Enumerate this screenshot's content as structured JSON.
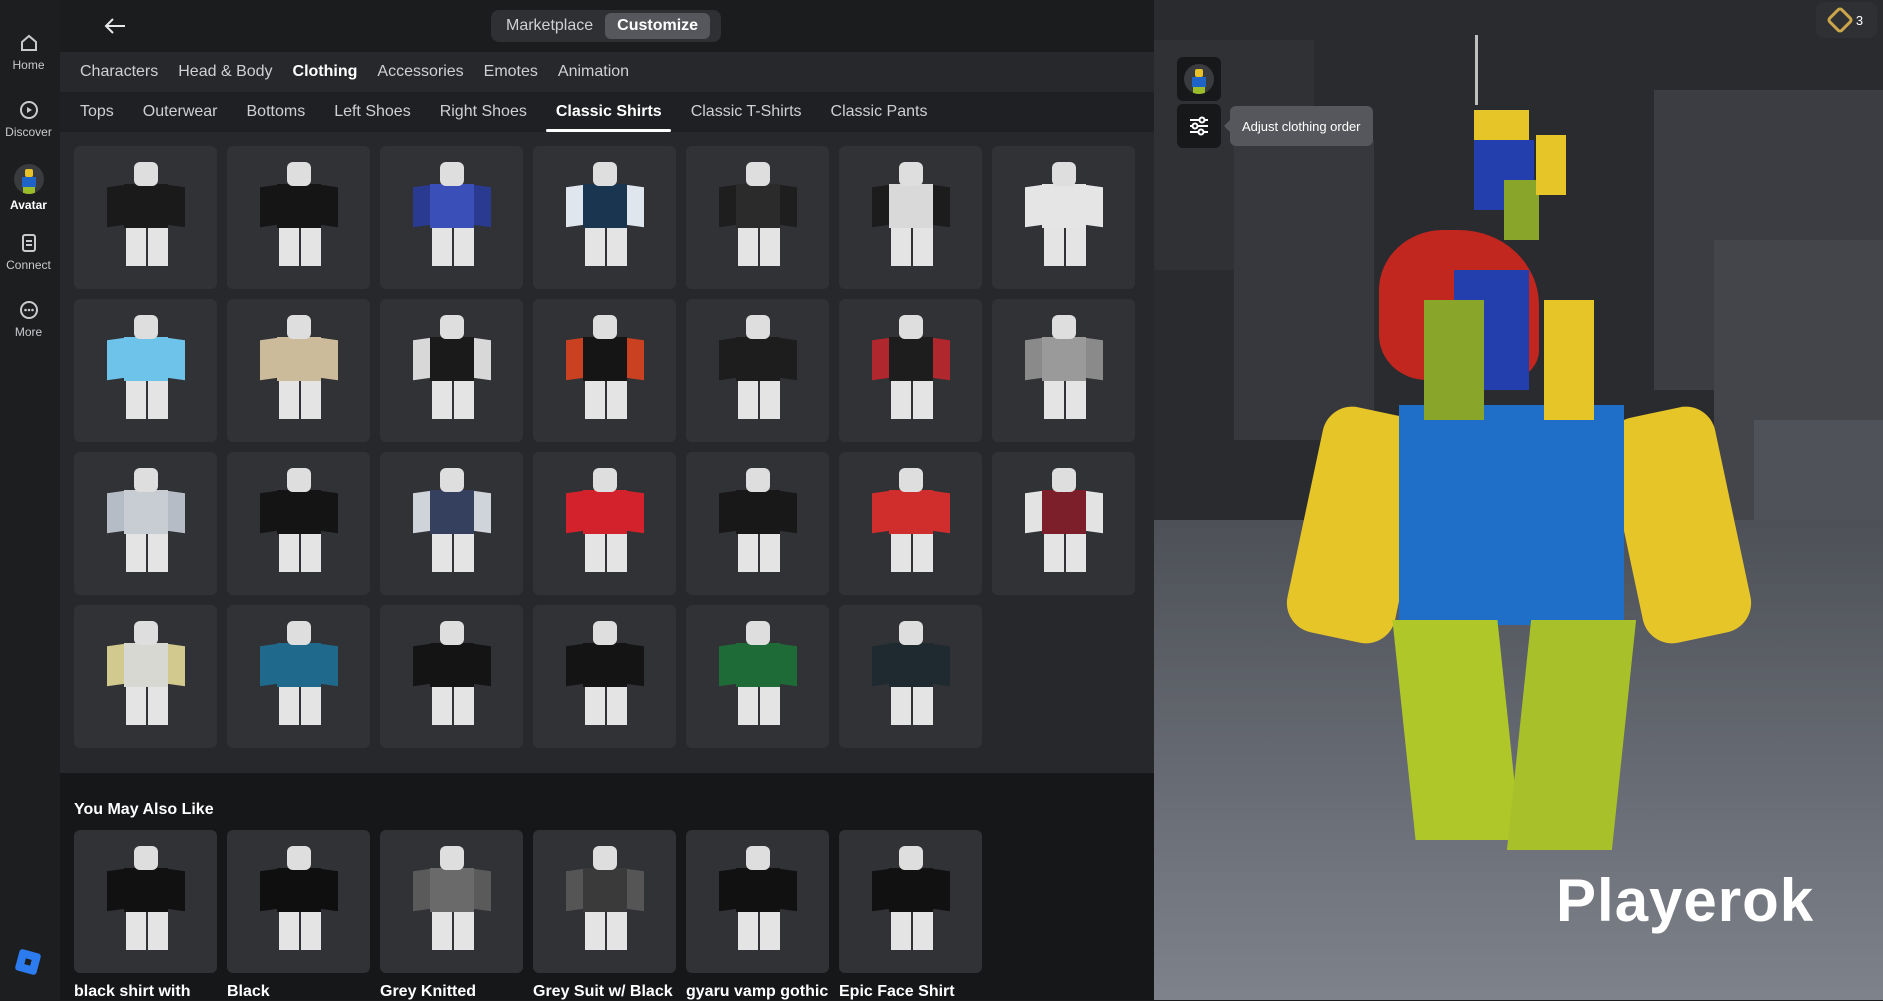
{
  "nav": {
    "items": [
      {
        "label": "Home",
        "icon": "home-icon"
      },
      {
        "label": "Discover",
        "icon": "discover-icon"
      },
      {
        "label": "Avatar",
        "icon": "avatar-icon"
      },
      {
        "label": "Connect",
        "icon": "connect-icon"
      },
      {
        "label": "More",
        "icon": "more-icon"
      }
    ]
  },
  "header": {
    "segments": [
      "Marketplace",
      "Customize"
    ],
    "active_segment": "Customize"
  },
  "categories": [
    "Characters",
    "Head & Body",
    "Clothing",
    "Accessories",
    "Emotes",
    "Animation"
  ],
  "active_category": "Clothing",
  "subcategories": [
    "Tops",
    "Outerwear",
    "Bottoms",
    "Left Shoes",
    "Right Shoes",
    "Classic Shirts",
    "Classic T-Shirts",
    "Classic Pants"
  ],
  "active_subcategory": "Classic Shirts",
  "items": [
    {
      "shirt": "#1a1a1a",
      "sleeve": "#1a1a1a"
    },
    {
      "shirt": "#151515",
      "sleeve": "#151515"
    },
    {
      "shirt": "#3b4fb8",
      "sleeve": "#2a3a90"
    },
    {
      "shirt": "#1a3550",
      "sleeve": "#e0e6ee"
    },
    {
      "shirt": "#2b2b2b",
      "sleeve": "#1e1e1e"
    },
    {
      "shirt": "#d9d9d9",
      "sleeve": "#1c1c1c"
    },
    {
      "shirt": "#e5e5e5",
      "sleeve": "#e5e5e5"
    },
    {
      "shirt": "#6ec3ea",
      "sleeve": "#6ec3ea"
    },
    {
      "shirt": "#cbbb9a",
      "sleeve": "#cbbb9a"
    },
    {
      "shirt": "#1a1a1a",
      "sleeve": "#d8d8d8"
    },
    {
      "shirt": "#151515",
      "sleeve": "#c94120"
    },
    {
      "shirt": "#1d1d1d",
      "sleeve": "#1d1d1d"
    },
    {
      "shirt": "#1d1d1d",
      "sleeve": "#b0272d"
    },
    {
      "shirt": "#9a9a9a",
      "sleeve": "#8a8a8a"
    },
    {
      "shirt": "#c8cdd4",
      "sleeve": "#b6bcc5"
    },
    {
      "shirt": "#141414",
      "sleeve": "#141414"
    },
    {
      "shirt": "#35405f",
      "sleeve": "#cfd3da"
    },
    {
      "shirt": "#d3222b",
      "sleeve": "#d3222b"
    },
    {
      "shirt": "#181818",
      "sleeve": "#181818"
    },
    {
      "shirt": "#cf2e2c",
      "sleeve": "#cf2e2c"
    },
    {
      "shirt": "#7c1f2a",
      "sleeve": "#e3e3e3"
    },
    {
      "shirt": "#d8d8d2",
      "sleeve": "#d2c98e"
    },
    {
      "shirt": "#1f6a8c",
      "sleeve": "#1f6a8c"
    },
    {
      "shirt": "#141414",
      "sleeve": "#141414"
    },
    {
      "shirt": "#141414",
      "sleeve": "#141414"
    },
    {
      "shirt": "#1f6b38",
      "sleeve": "#1f6b38"
    },
    {
      "shirt": "#1f2a30",
      "sleeve": "#1f2a30"
    }
  ],
  "also_like": {
    "title": "You May Also Like",
    "items": [
      {
        "name": "black shirt with",
        "shirt": "#111111",
        "sleeve": "#111111"
      },
      {
        "name": "Black",
        "shirt": "#0f0f0f",
        "sleeve": "#0f0f0f"
      },
      {
        "name": "Grey Knitted",
        "shirt": "#6a6a6a",
        "sleeve": "#5a5a5a"
      },
      {
        "name": "Grey Suit w/ Black",
        "shirt": "#3a3a3a",
        "sleeve": "#555555"
      },
      {
        "name": "gyaru vamp gothic",
        "shirt": "#111111",
        "sleeve": "#111111"
      },
      {
        "name": "Epic Face Shirt",
        "shirt": "#111111",
        "sleeve": "#111111"
      }
    ]
  },
  "scene": {
    "tooltip": "Adjust clothing order",
    "robux": "3",
    "username": "Playerok"
  }
}
